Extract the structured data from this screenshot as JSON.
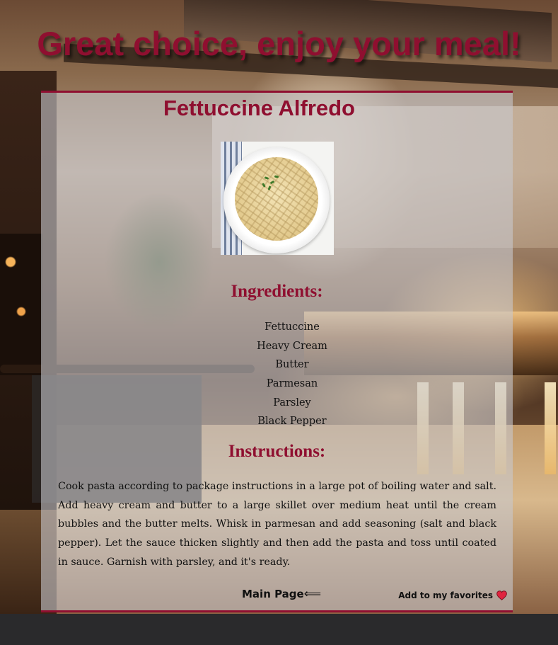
{
  "header": {
    "headline": "Great choice, enjoy your meal!"
  },
  "recipe": {
    "title": "Fettuccine Alfredo",
    "photo_icon": "fettuccine-alfredo-photo",
    "ingredients_heading": "Ingredients:",
    "ingredients": [
      "Fettuccine",
      "Heavy Cream",
      "Butter",
      "Parmesan",
      "Parsley",
      "Black Pepper"
    ],
    "instructions_heading": "Instructions:",
    "instructions": "Cook pasta according to package instructions in a large pot of boiling water and salt. Add heavy cream and butter to a large skillet over medium heat until the cream bubbles and the butter melts. Whisk in parmesan and add seasoning (salt and black pepper). Let the sauce thicken slightly and then add the pasta and toss until coated in sauce. Garnish with parsley, and it's ready."
  },
  "footer": {
    "main_page_label": "Main Page",
    "main_page_arrow": "⟸",
    "favorites_label": "Add to my favorites",
    "favorites_icon": "heart-icon"
  },
  "colors": {
    "accent": "#8f0f30",
    "heart": "#e0243f"
  }
}
